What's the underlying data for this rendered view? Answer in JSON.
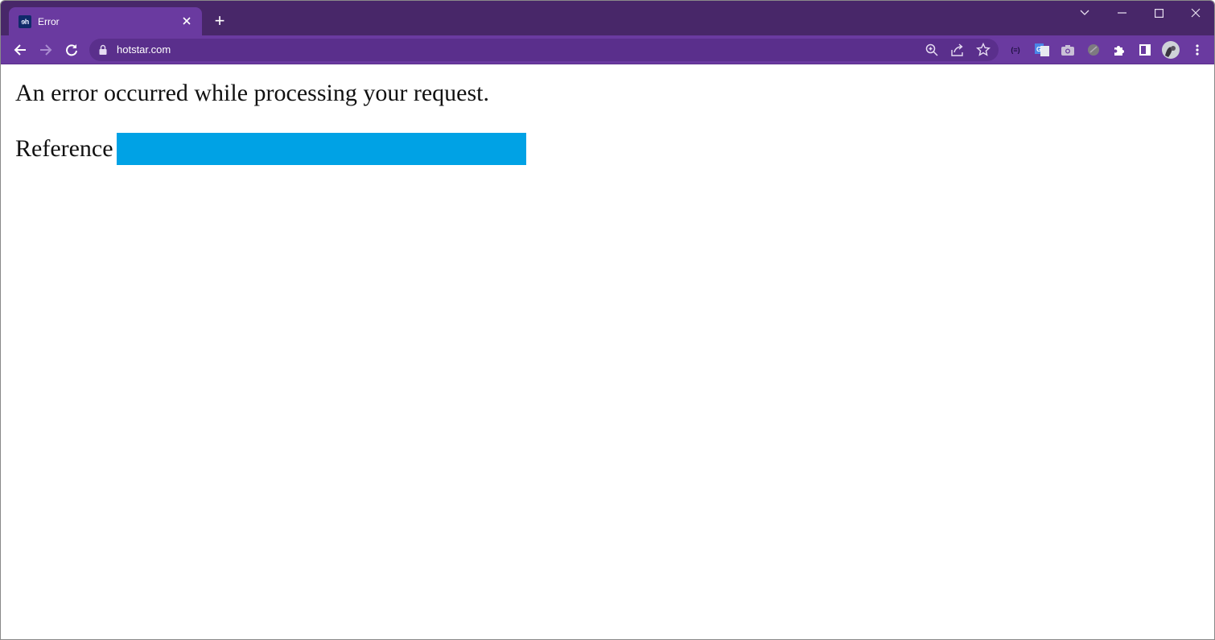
{
  "browser": {
    "tab": {
      "title": "Error",
      "favicon_text": "ɘh",
      "favicon_icon": "hotstar-favicon-icon",
      "close_icon": "close-icon"
    },
    "new_tab_label": "+",
    "window_controls": {
      "tab_search": "chevron-down-icon",
      "minimize": "minimize-icon",
      "maximize": "maximize-icon",
      "close": "close-icon"
    },
    "toolbar": {
      "back": "arrow-left-icon",
      "forward": "arrow-right-icon",
      "reload": "reload-icon",
      "url": "hotstar.com",
      "omnibox_icons": [
        "zoom-icon",
        "share-icon",
        "star-icon"
      ],
      "extensions": [
        "code-extension-icon",
        "google-translate-icon",
        "camera-extension-icon",
        "gray-extension-icon",
        "puzzle-icon",
        "side-panel-icon",
        "profile-avatar",
        "kebab-menu-icon"
      ],
      "code_ext_text": "(≡)"
    },
    "colors": {
      "tabstrip": "#482769",
      "active_tab": "#6a3aa0",
      "omnibox": "#5a2f8c",
      "redaction": "#00a2e5"
    }
  },
  "page": {
    "error_message": "An error occurred while processing your request.",
    "reference_label": "Reference",
    "reference_value_redacted": true
  }
}
